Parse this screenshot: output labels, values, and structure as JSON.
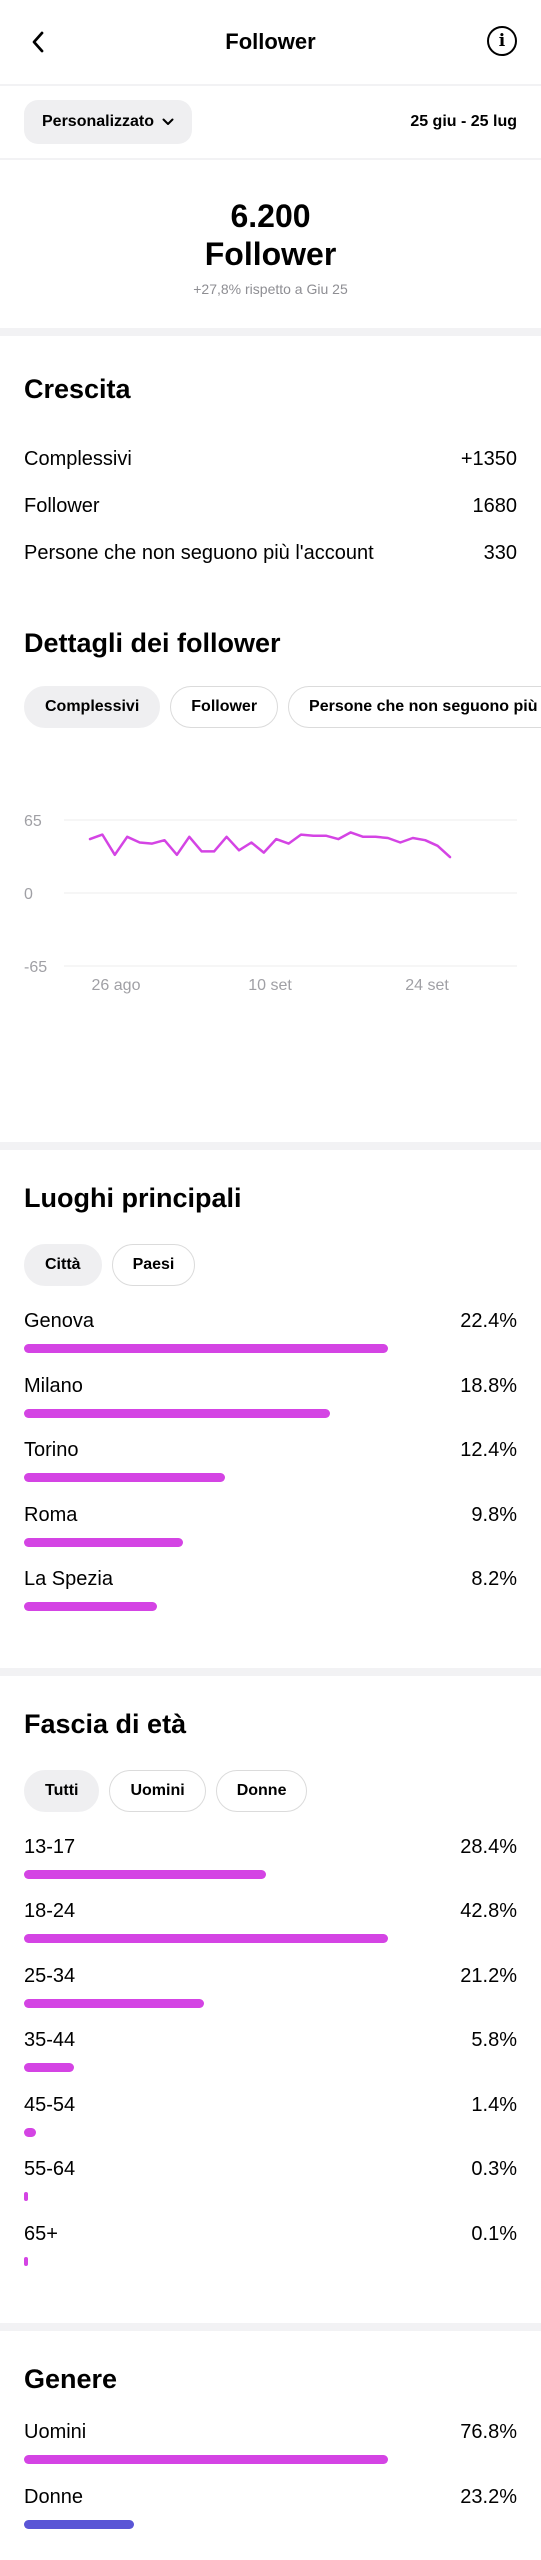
{
  "header": {
    "title": "Follower",
    "back_icon": "chevron-left-icon",
    "info_icon": "info-icon"
  },
  "filter": {
    "range_label": "Personalizzato",
    "date_range": "25 giu - 25 lug"
  },
  "summary": {
    "count": "6.200",
    "label": "Follower",
    "delta": "+27,8% rispetto a Giu 25"
  },
  "growth": {
    "title": "Crescita",
    "rows": [
      {
        "label": "Complessivi",
        "value": "+1350"
      },
      {
        "label": "Follower",
        "value": "1680"
      },
      {
        "label": "Persone che non seguono più l'account",
        "value": "330"
      }
    ]
  },
  "details": {
    "title": "Dettagli dei follower",
    "tabs": [
      "Complessivi",
      "Follower",
      "Persone che non seguono più l'account"
    ]
  },
  "chart_data": {
    "type": "line",
    "x_tick_labels": [
      "26 ago",
      "10 set",
      "24 set"
    ],
    "y_tick_labels": [
      "65",
      "0",
      "-65"
    ],
    "ylim": [
      -65,
      65
    ],
    "grid": true,
    "series": [
      {
        "values": [
          48,
          52,
          34,
          50,
          45,
          44,
          47,
          34,
          50,
          37,
          37,
          50,
          38,
          45,
          36,
          48,
          44,
          52,
          51,
          51,
          48,
          54,
          50,
          50,
          49,
          45,
          49,
          47,
          42,
          32
        ],
        "color": "#d444e4"
      }
    ]
  },
  "places": {
    "title": "Luoghi principali",
    "tabs": [
      "Città",
      "Paesi"
    ],
    "rows": [
      {
        "label": "Genova",
        "pct": "22.4%",
        "fraction": 1.0
      },
      {
        "label": "Milano",
        "pct": "18.8%",
        "fraction": 0.84
      },
      {
        "label": "Torino",
        "pct": "12.4%",
        "fraction": 0.553
      },
      {
        "label": "Roma",
        "pct": "9.8%",
        "fraction": 0.437
      },
      {
        "label": "La Spezia",
        "pct": "8.2%",
        "fraction": 0.366
      }
    ]
  },
  "age": {
    "title": "Fascia di età",
    "tabs": [
      "Tutti",
      "Uomini",
      "Donne"
    ],
    "rows": [
      {
        "label": "13-17",
        "pct": "28.4%",
        "fraction": 0.664
      },
      {
        "label": "18-24",
        "pct": "42.8%",
        "fraction": 1.0
      },
      {
        "label": "25-34",
        "pct": "21.2%",
        "fraction": 0.495
      },
      {
        "label": "35-44",
        "pct": "5.8%",
        "fraction": 0.136
      },
      {
        "label": "45-54",
        "pct": "1.4%",
        "fraction": 0.033
      },
      {
        "label": "55-64",
        "pct": "0.3%",
        "fraction": 0.011
      },
      {
        "label": "65+",
        "pct": "0.1%",
        "fraction": 0.011
      }
    ]
  },
  "gender": {
    "title": "Genere",
    "rows": [
      {
        "label": "Uomini",
        "pct": "76.8%",
        "fraction": 1.0,
        "color": "#d444e4"
      },
      {
        "label": "Donne",
        "pct": "23.2%",
        "fraction": 0.302,
        "color": "#5a55d6"
      }
    ]
  },
  "colors": {
    "accent": "#d444e4",
    "secondary": "#5a55d6",
    "pill_bg": "#efeff1",
    "divider": "#f2f2f4"
  }
}
